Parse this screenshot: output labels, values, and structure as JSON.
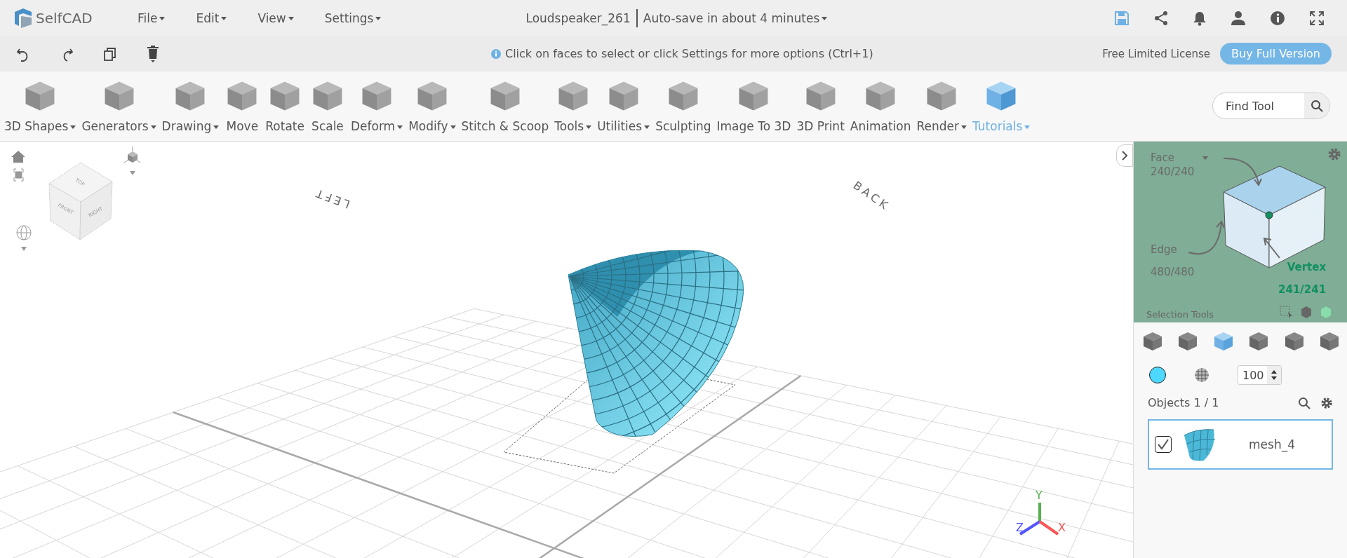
{
  "app": {
    "name": "SelfCAD"
  },
  "menu": [
    {
      "label": "File"
    },
    {
      "label": "Edit"
    },
    {
      "label": "View"
    },
    {
      "label": "Settings"
    }
  ],
  "document": {
    "title": "Loudspeaker_261",
    "autosave": "Auto-save in about 4 minutes"
  },
  "info_bar": {
    "hint": "Click on faces to select or click Settings for more options (Ctrl+1)",
    "license": "Free Limited License",
    "buy_button": "Buy Full Version"
  },
  "tools": [
    {
      "label": "3D Shapes",
      "dropdown": true,
      "highlighted": false
    },
    {
      "label": "Generators",
      "dropdown": true,
      "highlighted": false
    },
    {
      "label": "Drawing",
      "dropdown": true,
      "highlighted": false
    },
    {
      "label": "Move",
      "dropdown": false,
      "highlighted": false
    },
    {
      "label": "Rotate",
      "dropdown": false,
      "highlighted": false
    },
    {
      "label": "Scale",
      "dropdown": false,
      "highlighted": false
    },
    {
      "label": "Deform",
      "dropdown": true,
      "highlighted": false
    },
    {
      "label": "Modify",
      "dropdown": true,
      "highlighted": false
    },
    {
      "label": "Stitch & Scoop",
      "dropdown": false,
      "highlighted": false
    },
    {
      "label": "Tools",
      "dropdown": true,
      "highlighted": false
    },
    {
      "label": "Utilities",
      "dropdown": true,
      "highlighted": false
    },
    {
      "label": "Sculpting",
      "dropdown": false,
      "highlighted": false
    },
    {
      "label": "Image To 3D",
      "dropdown": false,
      "highlighted": false
    },
    {
      "label": "3D Print",
      "dropdown": false,
      "highlighted": false
    },
    {
      "label": "Animation",
      "dropdown": false,
      "highlighted": false
    },
    {
      "label": "Render",
      "dropdown": true,
      "highlighted": false
    },
    {
      "label": "Tutorials",
      "dropdown": true,
      "highlighted": true
    }
  ],
  "find_tool": {
    "placeholder": "Find Tool"
  },
  "viewport": {
    "view_cube": {
      "top": "TOP",
      "front": "FRONT",
      "right": "RIGHT"
    },
    "floor_labels": [
      "LEFT",
      "BACK"
    ],
    "axes": {
      "x": "X",
      "y": "Y",
      "z": "Z"
    }
  },
  "selection": {
    "types": [
      {
        "label": "Face",
        "count": "240/240",
        "selected": false
      },
      {
        "label": "Edge",
        "count": "480/480",
        "selected": false
      },
      {
        "label": "Vertex",
        "count": "241/241",
        "selected": true
      }
    ],
    "title": "Selection Tools"
  },
  "view_modes": [
    {
      "selected": false
    },
    {
      "selected": false
    },
    {
      "selected": true
    },
    {
      "selected": false
    },
    {
      "selected": false
    },
    {
      "selected": false
    }
  ],
  "material": {
    "color": "#4dd9ff",
    "opacity": "100"
  },
  "objects": {
    "title": "Objects 1 / 1",
    "items": [
      {
        "name": "mesh_4",
        "checked": true,
        "selected": true
      }
    ]
  }
}
